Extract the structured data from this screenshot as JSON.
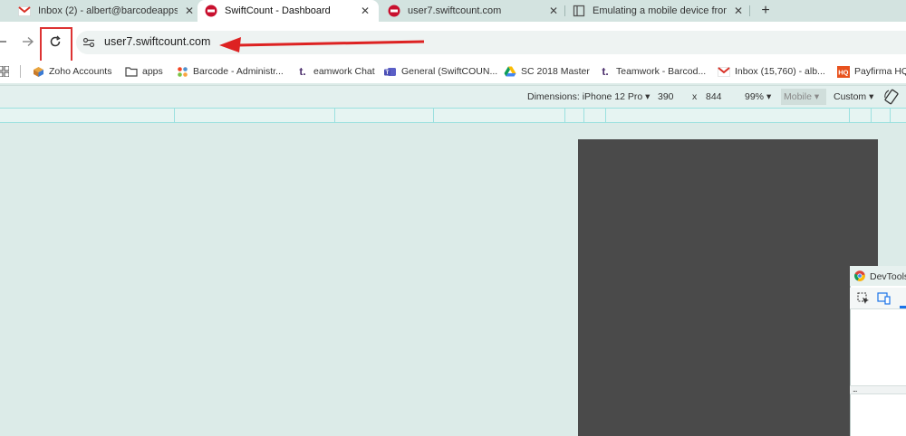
{
  "tabs": [
    {
      "title": "Inbox (2) - albert@barcodeapps",
      "favicon": "gmail-icon",
      "active": false
    },
    {
      "title": "SwiftCount - Dashboard",
      "favicon": "swiftcount-icon",
      "active": true
    },
    {
      "title": "user7.swiftcount.com",
      "favicon": "swiftcount-icon",
      "active": false
    },
    {
      "title": "Emulating a mobile device from",
      "favicon": "book-icon",
      "active": false
    }
  ],
  "new_tab_label": "+",
  "close_glyph": "✕",
  "address_bar": {
    "url": "user7.swiftcount.com"
  },
  "annotation": {
    "color": "#dd2222"
  },
  "bookmarks": [
    {
      "label": "Zoho Accounts",
      "icon": "zoho-icon"
    },
    {
      "label": "apps",
      "icon": "folder-icon"
    },
    {
      "label": "Barcode - Administr...",
      "icon": "joomla-icon"
    },
    {
      "label": "eamwork Chat",
      "icon": "teamwork-icon"
    },
    {
      "label": "General (SwiftCOUN...",
      "icon": "teams-icon"
    },
    {
      "label": "SC 2018 Master",
      "icon": "drive-icon"
    },
    {
      "label": "Teamwork - Barcod...",
      "icon": "teamwork-icon"
    },
    {
      "label": "Inbox (15,760) - alb...",
      "icon": "gmail-icon"
    },
    {
      "label": "Payfirma HQ",
      "icon": "hq-icon"
    }
  ],
  "device_toolbar": {
    "dimensions_label": "Dimensions: iPhone 12 Pro",
    "width": "390",
    "times": "x",
    "height": "844",
    "zoom": "99%",
    "device_type": "Mobile",
    "throttle": "Custom",
    "dropdown": "▾"
  },
  "devtools": {
    "title": "DevTools",
    "ellipsis": "..."
  },
  "colors": {
    "viewport_bg": "#4a4a4a",
    "page_bg": "#dcebe8",
    "accent": "#1a73e8"
  }
}
